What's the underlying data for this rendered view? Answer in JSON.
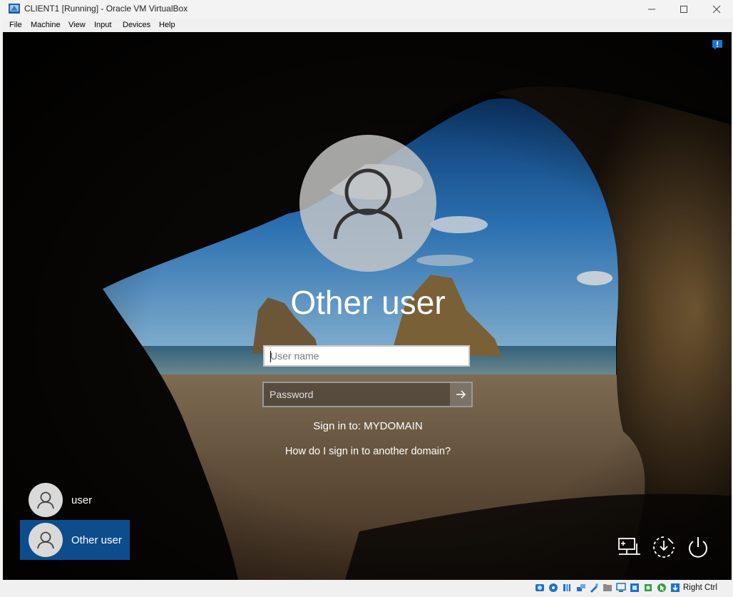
{
  "window": {
    "title": "CLIENT1 [Running] - Oracle VM VirtualBox",
    "app_icon": "virtualbox-icon"
  },
  "menu": [
    "File",
    "Machine",
    "View",
    "Input",
    "Devices",
    "Help"
  ],
  "login": {
    "display_name": "Other user",
    "username_placeholder": "User name",
    "password_placeholder": "Password",
    "sign_in_to": "Sign in to: MYDOMAIN",
    "other_domain_link": "How do I sign in to another domain?"
  },
  "user_tiles": [
    {
      "label": "user",
      "selected": false
    },
    {
      "label": "Other user",
      "selected": true
    }
  ],
  "bottom_icons": [
    "network-icon",
    "ease-of-access-icon",
    "power-icon"
  ],
  "statusbar": {
    "host_key": "Right Ctrl",
    "icons": [
      "hard-disk-icon",
      "optical-drive-icon",
      "audio-icon",
      "network-adapter-icon",
      "usb-icon",
      "shared-folders-icon",
      "display-icon",
      "video-capture-icon",
      "cpu-icon",
      "mouse-integration-icon",
      "keyboard-icon"
    ]
  },
  "colors": {
    "selected_tile": "#0d4d8c",
    "sky": "#2f7ec8"
  }
}
